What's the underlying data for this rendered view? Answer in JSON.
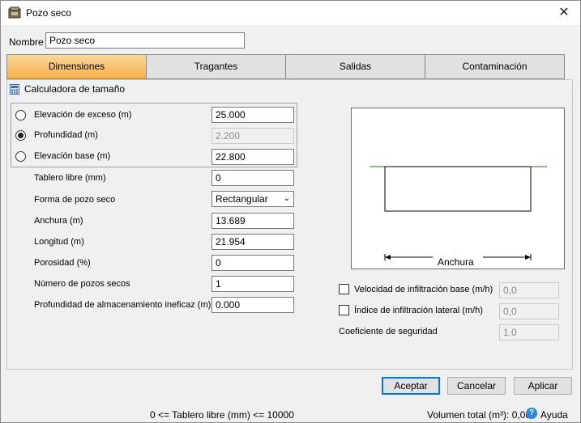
{
  "window": {
    "title": "Pozo seco"
  },
  "name_field": {
    "label": "Nombre",
    "value": "Pozo seco"
  },
  "tabs": [
    {
      "label": "Dimensiones"
    },
    {
      "label": "Tragantes"
    },
    {
      "label": "Salidas"
    },
    {
      "label": "Contaminación"
    }
  ],
  "calculator": {
    "label": "Calculadora de tamaño",
    "options": [
      {
        "label": "Elevación de exceso (m)",
        "value": "25.000"
      },
      {
        "label": "Profundidad (m)",
        "value": "2.200"
      },
      {
        "label": "Elevación base (m)",
        "value": "22.800"
      }
    ]
  },
  "fields": {
    "tablero": {
      "label": "Tablero libre (mm)",
      "value": "0"
    },
    "forma": {
      "label": "Forma de pozo seco",
      "value": "Rectangular"
    },
    "anchura": {
      "label": "Anchura (m)",
      "value": "13.689"
    },
    "longitud": {
      "label": "Longitud (m)",
      "value": "21.954"
    },
    "porosidad": {
      "label": "Porosidad (%)",
      "value": "0"
    },
    "numero": {
      "label": "Número de pozos secos",
      "value": "1"
    },
    "prof_ineficaz": {
      "label": "Profundidad de almacenamiento ineficaz (m)",
      "value": "0.000"
    }
  },
  "preview": {
    "dimension_label": "Anchura"
  },
  "infiltration": {
    "base": {
      "label": "Velocidad de infiltración base (m/h)",
      "value": "0,0"
    },
    "lateral": {
      "label": "Índice de infiltración lateral (m/h)",
      "value": "0,0"
    },
    "safety": {
      "label": "Coeficiente de seguridad",
      "value": "1,0"
    }
  },
  "buttons": {
    "accept": "Aceptar",
    "cancel": "Cancelar",
    "apply": "Aplicar"
  },
  "status": {
    "range": "0 <= Tablero libre (mm) <= 10000",
    "volume": "Volumen total (m³): 0,000",
    "help": "Ayuda"
  }
}
